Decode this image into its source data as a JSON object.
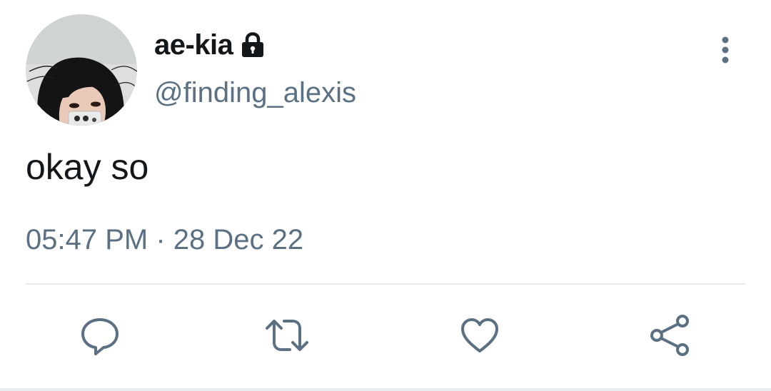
{
  "user": {
    "display_name": "ae-kia",
    "handle": "@finding_alexis",
    "protected": true,
    "avatar": "profile-photo"
  },
  "tweet": {
    "text": "okay so",
    "time": "05:47 PM",
    "separator": "·",
    "date": "28 Dec 22"
  },
  "icons": {
    "lock": "lock-icon",
    "more": "more-vertical-icon",
    "reply": "reply-icon",
    "retweet": "retweet-icon",
    "like": "heart-icon",
    "share": "share-icon"
  },
  "colors": {
    "text_primary": "#14171a",
    "text_secondary": "#5b7083",
    "divider": "#e6ecf0"
  }
}
